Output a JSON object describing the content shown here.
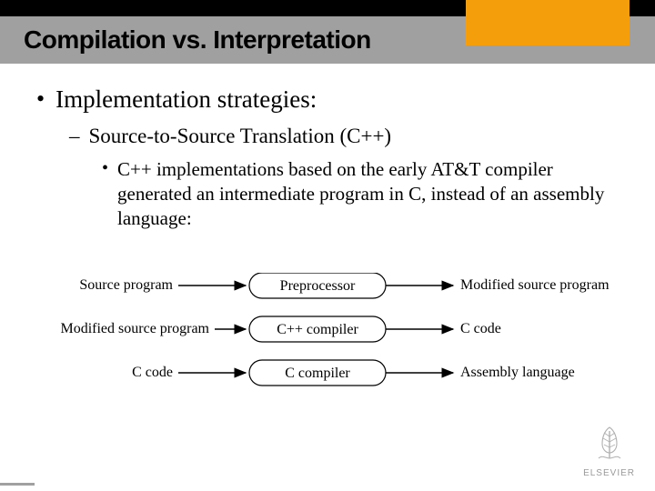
{
  "slide": {
    "title": "Compilation vs. Interpretation",
    "bullet1": "Implementation strategies:",
    "bullet2": "Source-to-Source Translation (C++)",
    "bullet3": "C++ implementations based on the early AT&T compiler generated an intermediate program in C, instead of an assembly language:"
  },
  "diagram": {
    "left1": "Source program",
    "box1": "Preprocessor",
    "right1": "Modified source program",
    "left2": "Modified source program",
    "box2": "C++ compiler",
    "right2": "C code",
    "left3": "C code",
    "box3": "C compiler",
    "right3": "Assembly language"
  },
  "logo": "ELSEVIER"
}
